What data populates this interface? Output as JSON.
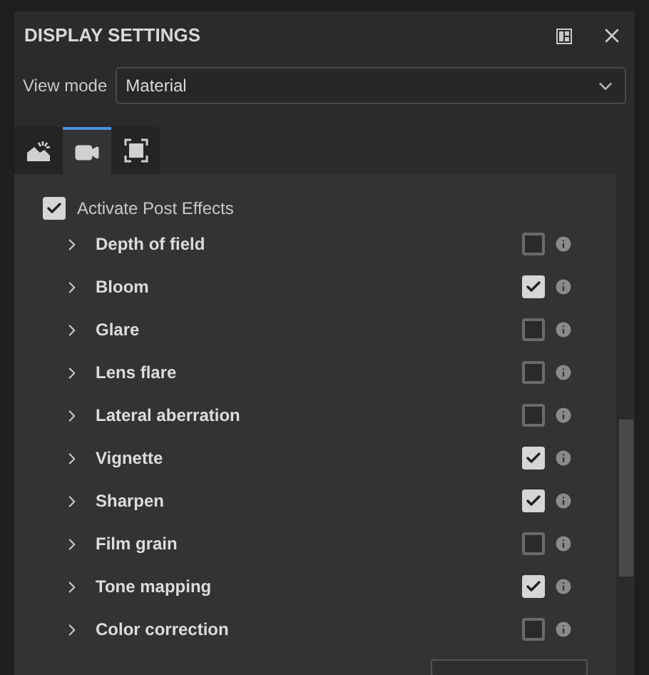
{
  "panel": {
    "title": "DISPLAY SETTINGS"
  },
  "view_mode": {
    "label": "View mode",
    "value": "Material"
  },
  "tabs": [
    {
      "kind": "scene",
      "selected": false
    },
    {
      "kind": "camera",
      "selected": true
    },
    {
      "kind": "frame",
      "selected": false
    }
  ],
  "activate": {
    "label": "Activate Post Effects",
    "checked": true
  },
  "effects": [
    {
      "label": "Depth of field",
      "checked": false
    },
    {
      "label": "Bloom",
      "checked": true
    },
    {
      "label": "Glare",
      "checked": false
    },
    {
      "label": "Lens flare",
      "checked": false
    },
    {
      "label": "Lateral aberration",
      "checked": false
    },
    {
      "label": "Vignette",
      "checked": true
    },
    {
      "label": "Sharpen",
      "checked": true
    },
    {
      "label": "Film grain",
      "checked": false
    },
    {
      "label": "Tone mapping",
      "checked": true
    },
    {
      "label": "Color correction",
      "checked": false
    }
  ]
}
